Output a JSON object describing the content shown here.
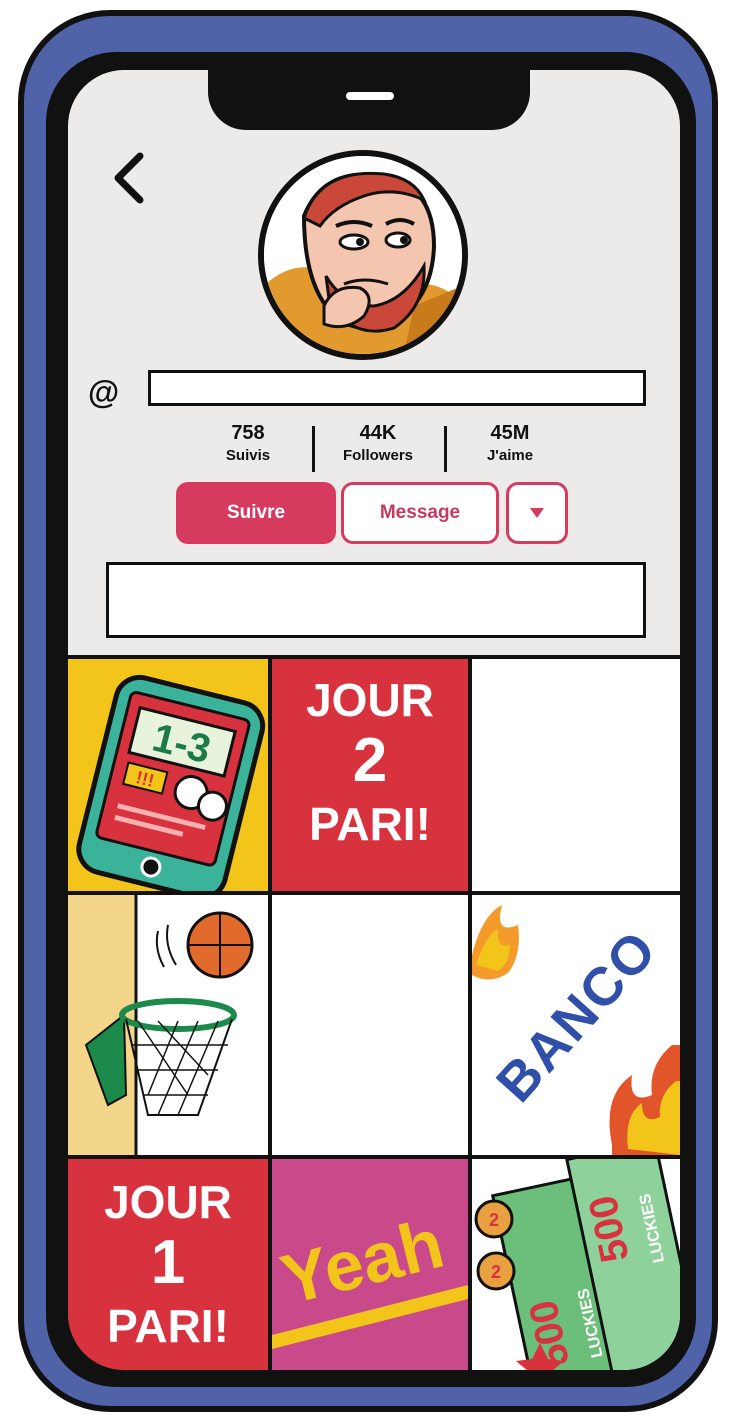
{
  "profile": {
    "at_symbol": "@",
    "handle": "",
    "bio": ""
  },
  "stats": [
    {
      "value": "758",
      "label": "Suivis"
    },
    {
      "value": "44K",
      "label": "Followers"
    },
    {
      "value": "45M",
      "label": "J'aime"
    }
  ],
  "actions": {
    "follow_label": "Suivre",
    "message_label": "Message",
    "more_icon": "caret-down-icon"
  },
  "posts": [
    {
      "kind": "phone-score",
      "score": "1-3",
      "badge": "!!!"
    },
    {
      "kind": "text",
      "lines": [
        "JOUR",
        "2",
        "PARI!"
      ]
    },
    {
      "kind": "blank"
    },
    {
      "kind": "basketball"
    },
    {
      "kind": "blank"
    },
    {
      "kind": "banco",
      "text": "BANCO"
    },
    {
      "kind": "text",
      "lines": [
        "JOUR",
        "1",
        "PARI!"
      ]
    },
    {
      "kind": "yeah",
      "text": "Yeah"
    },
    {
      "kind": "tickets",
      "amount": "500",
      "brand": "LUCKIES",
      "coin_a": "2",
      "coin_b": "2"
    }
  ],
  "colors": {
    "phone_frame": "#5063a8",
    "accent": "#d63a5e",
    "post_red": "#d8323f",
    "post_yellow": "#f3c41a",
    "post_magenta": "#c94a8b",
    "banco_blue": "#2f4fa8",
    "ticket_green": "#6cbf7a"
  }
}
